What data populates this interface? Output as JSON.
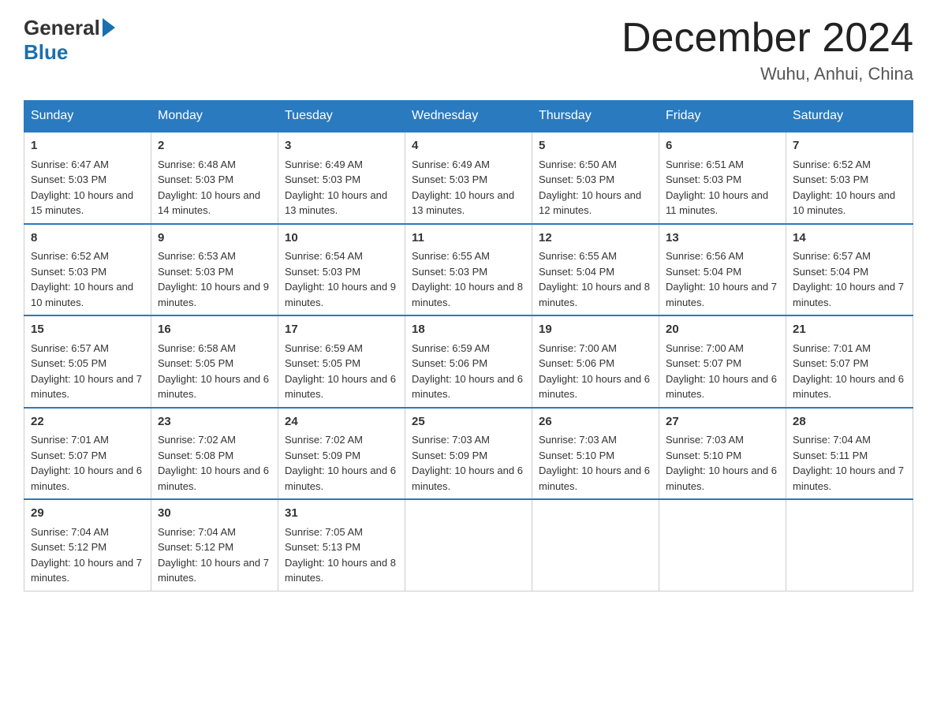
{
  "header": {
    "logo_line1": "General",
    "logo_line2": "Blue",
    "month_title": "December 2024",
    "location": "Wuhu, Anhui, China"
  },
  "days_of_week": [
    "Sunday",
    "Monday",
    "Tuesday",
    "Wednesday",
    "Thursday",
    "Friday",
    "Saturday"
  ],
  "weeks": [
    [
      {
        "day": "1",
        "sunrise": "6:47 AM",
        "sunset": "5:03 PM",
        "daylight": "10 hours and 15 minutes."
      },
      {
        "day": "2",
        "sunrise": "6:48 AM",
        "sunset": "5:03 PM",
        "daylight": "10 hours and 14 minutes."
      },
      {
        "day": "3",
        "sunrise": "6:49 AM",
        "sunset": "5:03 PM",
        "daylight": "10 hours and 13 minutes."
      },
      {
        "day": "4",
        "sunrise": "6:49 AM",
        "sunset": "5:03 PM",
        "daylight": "10 hours and 13 minutes."
      },
      {
        "day": "5",
        "sunrise": "6:50 AM",
        "sunset": "5:03 PM",
        "daylight": "10 hours and 12 minutes."
      },
      {
        "day": "6",
        "sunrise": "6:51 AM",
        "sunset": "5:03 PM",
        "daylight": "10 hours and 11 minutes."
      },
      {
        "day": "7",
        "sunrise": "6:52 AM",
        "sunset": "5:03 PM",
        "daylight": "10 hours and 10 minutes."
      }
    ],
    [
      {
        "day": "8",
        "sunrise": "6:52 AM",
        "sunset": "5:03 PM",
        "daylight": "10 hours and 10 minutes."
      },
      {
        "day": "9",
        "sunrise": "6:53 AM",
        "sunset": "5:03 PM",
        "daylight": "10 hours and 9 minutes."
      },
      {
        "day": "10",
        "sunrise": "6:54 AM",
        "sunset": "5:03 PM",
        "daylight": "10 hours and 9 minutes."
      },
      {
        "day": "11",
        "sunrise": "6:55 AM",
        "sunset": "5:03 PM",
        "daylight": "10 hours and 8 minutes."
      },
      {
        "day": "12",
        "sunrise": "6:55 AM",
        "sunset": "5:04 PM",
        "daylight": "10 hours and 8 minutes."
      },
      {
        "day": "13",
        "sunrise": "6:56 AM",
        "sunset": "5:04 PM",
        "daylight": "10 hours and 7 minutes."
      },
      {
        "day": "14",
        "sunrise": "6:57 AM",
        "sunset": "5:04 PM",
        "daylight": "10 hours and 7 minutes."
      }
    ],
    [
      {
        "day": "15",
        "sunrise": "6:57 AM",
        "sunset": "5:05 PM",
        "daylight": "10 hours and 7 minutes."
      },
      {
        "day": "16",
        "sunrise": "6:58 AM",
        "sunset": "5:05 PM",
        "daylight": "10 hours and 6 minutes."
      },
      {
        "day": "17",
        "sunrise": "6:59 AM",
        "sunset": "5:05 PM",
        "daylight": "10 hours and 6 minutes."
      },
      {
        "day": "18",
        "sunrise": "6:59 AM",
        "sunset": "5:06 PM",
        "daylight": "10 hours and 6 minutes."
      },
      {
        "day": "19",
        "sunrise": "7:00 AM",
        "sunset": "5:06 PM",
        "daylight": "10 hours and 6 minutes."
      },
      {
        "day": "20",
        "sunrise": "7:00 AM",
        "sunset": "5:07 PM",
        "daylight": "10 hours and 6 minutes."
      },
      {
        "day": "21",
        "sunrise": "7:01 AM",
        "sunset": "5:07 PM",
        "daylight": "10 hours and 6 minutes."
      }
    ],
    [
      {
        "day": "22",
        "sunrise": "7:01 AM",
        "sunset": "5:07 PM",
        "daylight": "10 hours and 6 minutes."
      },
      {
        "day": "23",
        "sunrise": "7:02 AM",
        "sunset": "5:08 PM",
        "daylight": "10 hours and 6 minutes."
      },
      {
        "day": "24",
        "sunrise": "7:02 AM",
        "sunset": "5:09 PM",
        "daylight": "10 hours and 6 minutes."
      },
      {
        "day": "25",
        "sunrise": "7:03 AM",
        "sunset": "5:09 PM",
        "daylight": "10 hours and 6 minutes."
      },
      {
        "day": "26",
        "sunrise": "7:03 AM",
        "sunset": "5:10 PM",
        "daylight": "10 hours and 6 minutes."
      },
      {
        "day": "27",
        "sunrise": "7:03 AM",
        "sunset": "5:10 PM",
        "daylight": "10 hours and 6 minutes."
      },
      {
        "day": "28",
        "sunrise": "7:04 AM",
        "sunset": "5:11 PM",
        "daylight": "10 hours and 7 minutes."
      }
    ],
    [
      {
        "day": "29",
        "sunrise": "7:04 AM",
        "sunset": "5:12 PM",
        "daylight": "10 hours and 7 minutes."
      },
      {
        "day": "30",
        "sunrise": "7:04 AM",
        "sunset": "5:12 PM",
        "daylight": "10 hours and 7 minutes."
      },
      {
        "day": "31",
        "sunrise": "7:05 AM",
        "sunset": "5:13 PM",
        "daylight": "10 hours and 8 minutes."
      },
      null,
      null,
      null,
      null
    ]
  ],
  "labels": {
    "sunrise": "Sunrise:",
    "sunset": "Sunset:",
    "daylight": "Daylight:"
  }
}
